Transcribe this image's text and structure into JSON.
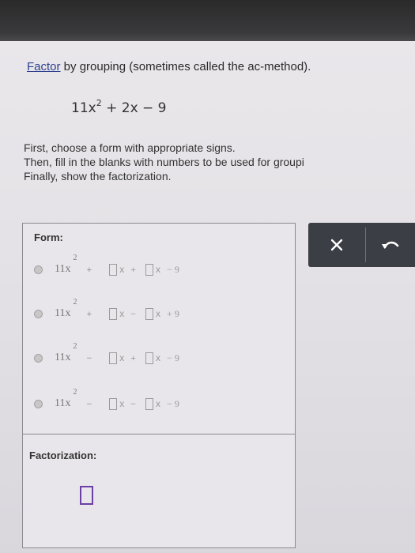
{
  "instruction": {
    "link": "Factor",
    "rest": " by grouping (sometimes called the ac-method)."
  },
  "expression": {
    "coef": "11x",
    "exp": "2",
    "rest": " + 2x − 9"
  },
  "steps": [
    "First, choose a form with appropriate signs.",
    "Then, fill in the blanks with numbers to be used for groupi",
    "Finally, show the factorization."
  ],
  "form": {
    "label": "Form:",
    "options": [
      {
        "term": "11x",
        "exp": "2",
        "op1": "+",
        "x1": "x",
        "op2": "+",
        "x2": "x",
        "const": "− 9"
      },
      {
        "term": "11x",
        "exp": "2",
        "op1": "+",
        "x1": "x",
        "op2": "−",
        "x2": "x",
        "const": "+ 9"
      },
      {
        "term": "11x",
        "exp": "2",
        "op1": "−",
        "x1": "x",
        "op2": "+",
        "x2": "x",
        "const": "− 9"
      },
      {
        "term": "11x",
        "exp": "2",
        "op1": "−",
        "x1": "x",
        "op2": "−",
        "x2": "x",
        "const": "− 9"
      }
    ]
  },
  "factorization": {
    "label": "Factorization:"
  },
  "toolbar": {
    "clear_icon": "close-icon",
    "undo_icon": "undo-icon",
    "bg_color": "#3c3e45"
  },
  "colors": {
    "link": "#2c3f8f",
    "answer_box": "#6b3fa5"
  }
}
